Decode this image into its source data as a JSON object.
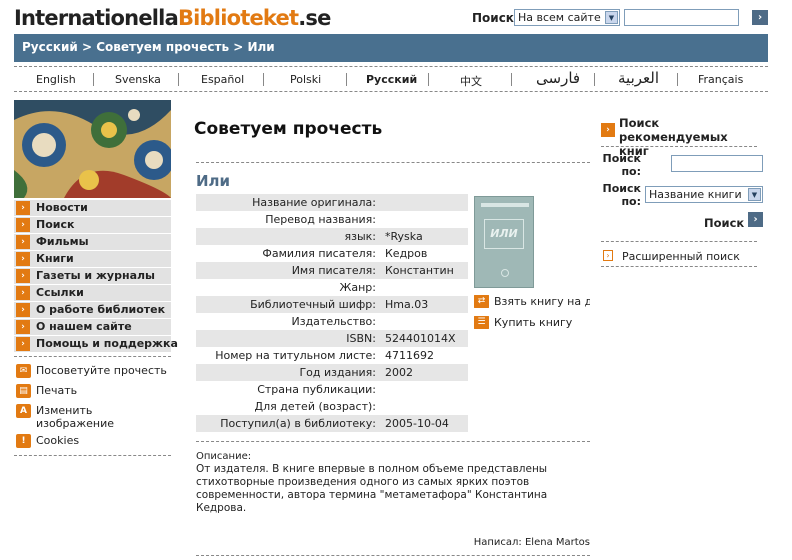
{
  "header": {
    "logo_part1": "Internationella",
    "logo_part2": "Biblioteket",
    "logo_part3": ".se",
    "search_label": "Поиск:",
    "search_scope": "На всем сайте",
    "search_value": ""
  },
  "breadcrumb": "Русский > Советуем прочесть > Или",
  "languages": [
    "English",
    "Svenska",
    "Español",
    "Polski",
    "Русский",
    "中文",
    "فارسی",
    "العربية",
    "Français"
  ],
  "active_language": "Русский",
  "nav": [
    "Новости",
    "Поиск",
    "Фильмы",
    "Книги",
    "Газеты и журналы",
    "Ссылки",
    "О работе библиотек",
    "О нашем сайте",
    "Помощь и поддержка"
  ],
  "tools": [
    {
      "label": "Посоветуйте прочесть",
      "icon": "mail-icon"
    },
    {
      "label": "Печать",
      "icon": "print-icon"
    },
    {
      "label": "Изменить изображение",
      "icon": "font-size-icon"
    },
    {
      "label": "Cookies",
      "icon": "exclamation-icon"
    }
  ],
  "page_title": "Советуем прочесть",
  "book": {
    "title": "Или",
    "cover_text": "ИЛИ",
    "rows": [
      {
        "label": "Название оригинала:",
        "value": ""
      },
      {
        "label": "Перевод названия:",
        "value": ""
      },
      {
        "label": "язык:",
        "value": "*Ryska"
      },
      {
        "label": "Фамилия писателя:",
        "value": "Кедров"
      },
      {
        "label": "Имя писателя:",
        "value": "Константин"
      },
      {
        "label": "Жанр:",
        "value": ""
      },
      {
        "label": "Библиотечный шифр:",
        "value": "Hma.03"
      },
      {
        "label": "Издательство:",
        "value": ""
      },
      {
        "label": "ISBN:",
        "value": "524401014X"
      },
      {
        "label": "Номер на титульном листе:",
        "value": "4711692"
      },
      {
        "label": "Год издания:",
        "value": "2002"
      },
      {
        "label": "Страна публикации:",
        "value": ""
      },
      {
        "label": "Для детей (возраст):",
        "value": ""
      },
      {
        "label": "Поступил(а) в библиотеку:",
        "value": "2005-10-04"
      }
    ],
    "actions": [
      "Взять книгу на д",
      "Купить книгу"
    ],
    "description_label": "Описание:",
    "description": "От издателя. В книге впервые в полном объеме представлены стихотворные произведения одного из самых ярких поэтов современности, автора термина \"метаметафора\" Константина Кедрова.",
    "author_note": "Написал: Elena Martos"
  },
  "right_search": {
    "title": "Поиск рекомендуемых книг",
    "label1": "Поиск по:",
    "label2": "Поиск по:",
    "select_value": "Название книги",
    "go_label": "Поиск",
    "advanced": "Расширенный поиск"
  },
  "colors": {
    "accent": "#e27a12",
    "bar": "#49708f",
    "title_blue": "#4e6b86"
  }
}
